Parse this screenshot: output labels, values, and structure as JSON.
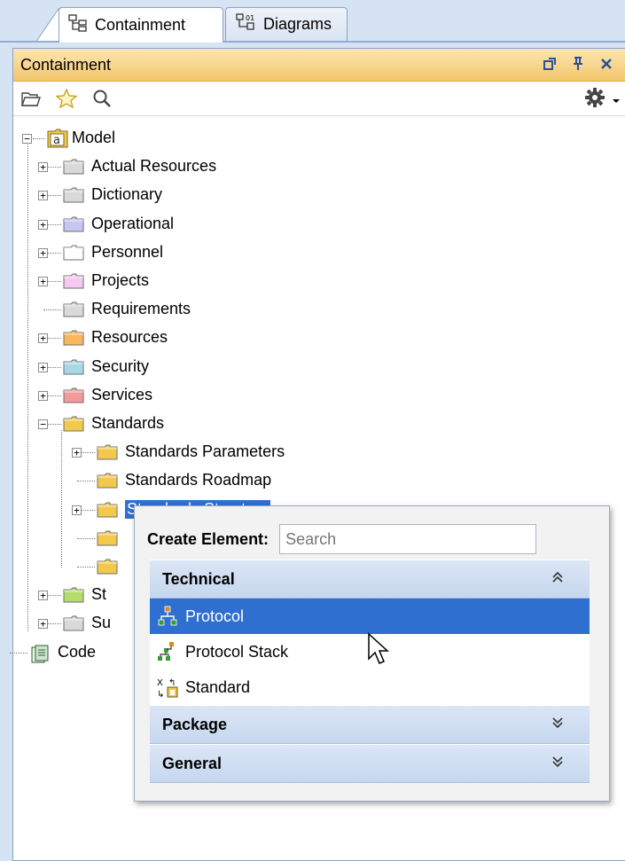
{
  "tabs": [
    {
      "label": "Containment",
      "icon": "containment-tree-icon",
      "active": true
    },
    {
      "label": "Diagrams",
      "icon": "diagrams-icon",
      "active": false
    }
  ],
  "panel": {
    "title": "Containment",
    "title_controls": [
      "undock-icon",
      "pin-icon",
      "close-icon"
    ],
    "toolbar": [
      "open-folder-icon",
      "favorite-star-icon",
      "search-icon",
      "gear-icon"
    ]
  },
  "tree": {
    "root": {
      "label": "Model",
      "icon": "model-icon",
      "expanded": true
    },
    "items": [
      {
        "label": "Actual Resources",
        "color": "#d9d9d9"
      },
      {
        "label": "Dictionary",
        "color": "#d9d9d9"
      },
      {
        "label": "Operational",
        "color": "#c6c6f3"
      },
      {
        "label": "Personnel",
        "color": "#ffffff"
      },
      {
        "label": "Projects",
        "color": "#f7c8f0"
      },
      {
        "label": "Requirements",
        "color": "#d9d9d9"
      },
      {
        "label": "Resources",
        "color": "#f7b75a"
      },
      {
        "label": "Security",
        "color": "#a8d8e6"
      },
      {
        "label": "Services",
        "color": "#f29a9a"
      },
      {
        "label": "Standards",
        "color": "#f2c94c"
      },
      {
        "label": "Standards Parameters",
        "color": "#f2c94c"
      },
      {
        "label": "Standards Roadmap",
        "color": "#f2c94c"
      },
      {
        "label": "Standards Structure",
        "color": "#f2c94c",
        "selected": true
      },
      {
        "label": "",
        "color": "#f2c94c"
      },
      {
        "label": "",
        "color": "#f2c94c"
      },
      {
        "label": "St",
        "color": "#b5dc6c"
      },
      {
        "label": "Su",
        "color": "#d9d9d9"
      },
      {
        "label": "Code",
        "color": "#8aa"
      }
    ]
  },
  "popup": {
    "create_label": "Create Element:",
    "search_placeholder": "Search",
    "categories": [
      {
        "label": "Technical",
        "chevron": "⌃⌃",
        "expanded": true,
        "items": [
          {
            "label": "Protocol",
            "icon": "protocol-icon",
            "selected": true
          },
          {
            "label": "Protocol Stack",
            "icon": "protocol-stack-icon"
          },
          {
            "label": "Standard",
            "icon": "standard-icon"
          }
        ]
      },
      {
        "label": "Package",
        "chevron": "⌄⌄",
        "expanded": false
      },
      {
        "label": "General",
        "chevron": "⌄⌄",
        "expanded": false
      }
    ]
  }
}
